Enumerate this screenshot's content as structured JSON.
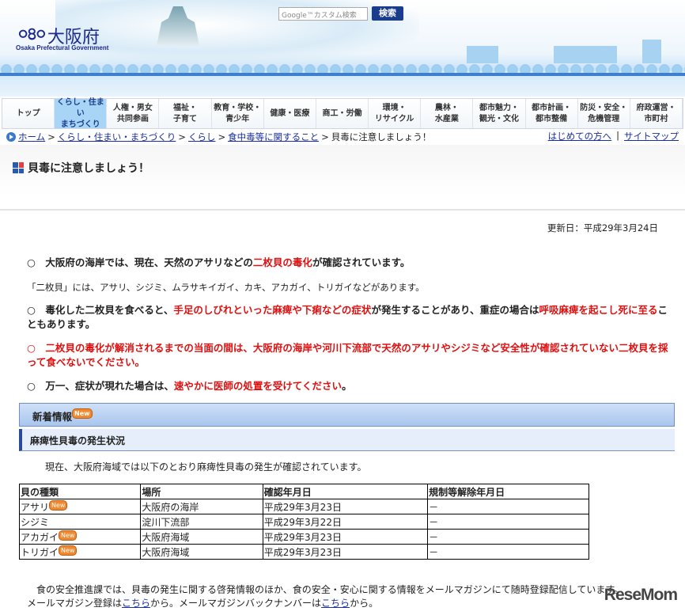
{
  "header": {
    "logo_name": "大阪府",
    "logo_en": "Osaka Prefectural Government",
    "search_placeholder": "Google™カスタム検索",
    "search_button": "検索"
  },
  "nav": [
    "トップ",
    "くらし・住まい\nまちづくり",
    "人権・男女\n共同参画",
    "福祉・\n子育て",
    "教育・学校・\n青少年",
    "健康・医療",
    "商工・労働",
    "環境・\nリサイクル",
    "農林・\n水産業",
    "都市魅力・\n観光・文化",
    "都市計画・\n都市整備",
    "防災・安全・\n危機管理",
    "府政運営・\n市町村"
  ],
  "nav_active": 1,
  "breadcrumb": {
    "items": [
      "ホーム",
      "くらし・住まい・まちづくり",
      "くらし",
      "食中毒等に関すること"
    ],
    "current": "貝毒に注意しましょう！",
    "sep": ">",
    "right": [
      "はじめての方へ",
      "サイトマップ"
    ],
    "right_sep": "|"
  },
  "page_title": "貝毒に注意しましょう！",
  "updated": "更新日：平成29年3月24日",
  "p1": {
    "a": "○　大阪府の海岸では、現在、天然のアサリなどの",
    "red": "二枚貝の毒化",
    "b": "が確認されています。"
  },
  "p2": "「二枚貝」には、アサリ、シジミ、ムラサキイガイ、カキ、アカガイ、トリガイなどがあります。",
  "p3": {
    "a": "○　毒化した二枚貝を食べると、",
    "red1": "手足のしびれといった麻痺や下痢などの症状",
    "b": "が発生することがあり、重症の場合は",
    "red2": "呼吸麻痺を起こし死に至る",
    "c": "こともあります。"
  },
  "p4": "○　二枚貝の毒化が解消されるまでの当面の間は、大阪府の海岸や河川下流部で天然のアサリやシジミなど安全性が確認されていない二枚貝を採って食べないでください。",
  "p5": {
    "a": "○　万一、症状が現れた場合は、",
    "red": "速やかに医師の処置を受けてください",
    "b": "。"
  },
  "new_info": {
    "label": "新着情報",
    "badge": "New"
  },
  "subsection": "麻痺性貝毒の発生状況",
  "intro": "現在、大阪府海域では以下のとおり麻痺性貝毒の発生が確認されています。",
  "table": {
    "headers": [
      "貝の種類",
      "場所",
      "確認年月日",
      "規制等解除年月日"
    ],
    "rows": [
      {
        "type": "アサリ",
        "new": true,
        "place": "大阪府の海岸",
        "date": "平成29年3月23日",
        "release": "－"
      },
      {
        "type": "シジミ",
        "new": false,
        "place": "淀川下流部",
        "date": "平成29年3月22日",
        "release": "－"
      },
      {
        "type": "アカガイ",
        "new": true,
        "place": "大阪府海域",
        "date": "平成29年3月23日",
        "release": "－"
      },
      {
        "type": "トリガイ",
        "new": true,
        "place": "大阪府海域",
        "date": "平成29年3月23日",
        "release": "－"
      }
    ]
  },
  "footer": {
    "line1": "　食の安全推進課では、貝毒の発生に関する啓発情報のほか、食の安全・安心に関する情報をメールマガジンにて随時登録配信しています。",
    "l2a": "メールマガジン登録は",
    "link": "こちら",
    "l2b": "から。メールマガジンバックナンバーは",
    "l2c": "から。"
  },
  "watermark": "ReseMom"
}
